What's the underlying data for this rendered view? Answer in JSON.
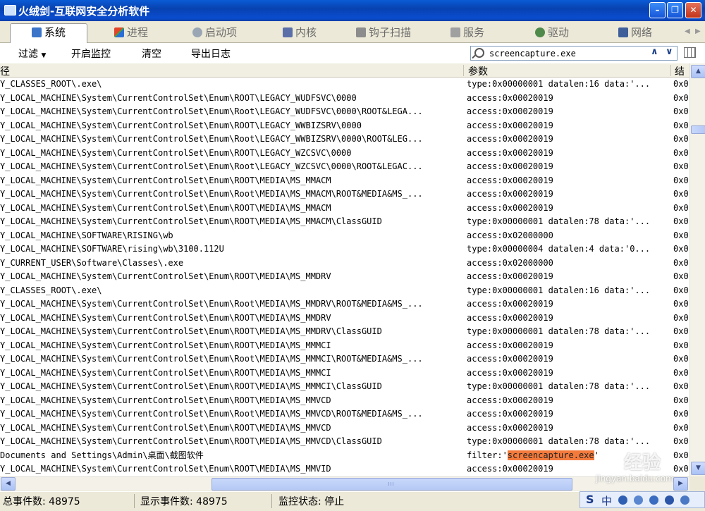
{
  "window": {
    "title": "火绒剑-互联网安全分析软件",
    "minimize": "–",
    "maximize": "❐",
    "close": "✕"
  },
  "tabs": [
    {
      "label": "系统",
      "icon": "monitor-icon",
      "active": true
    },
    {
      "label": "进程",
      "icon": "windows-flag-icon",
      "active": false
    },
    {
      "label": "启动项",
      "icon": "gear-icon",
      "active": false
    },
    {
      "label": "内核",
      "icon": "kernel-icon",
      "active": false
    },
    {
      "label": "钩子扫描",
      "icon": "hook-icon",
      "active": false
    },
    {
      "label": "服务",
      "icon": "service-icon",
      "active": false
    },
    {
      "label": "驱动",
      "icon": "driver-icon",
      "active": false
    },
    {
      "label": "网络",
      "icon": "network-icon",
      "active": false
    }
  ],
  "toolbar": {
    "filter": "过滤",
    "start_monitor": "开启监控",
    "clear": "清空",
    "export_log": "导出日志"
  },
  "search": {
    "value": "screencapture.exe",
    "up": "∧",
    "down": "∨"
  },
  "columns": {
    "path": "径",
    "params": "参数",
    "result": "结"
  },
  "rows": [
    {
      "path": "Y_CLASSES_ROOT\\.exe\\",
      "params": "type:0x00000001 datalen:16 data:'...",
      "result": "0x0"
    },
    {
      "path": "Y_LOCAL_MACHINE\\System\\CurrentControlSet\\Enum\\ROOT\\LEGACY_WUDFSVC\\0000",
      "params": "access:0x00020019",
      "result": "0x0"
    },
    {
      "path": "Y_LOCAL_MACHINE\\System\\CurrentControlSet\\Enum\\Root\\LEGACY_WUDFSVC\\0000\\ROOT&LEGA...",
      "params": "access:0x00020019",
      "result": "0x0"
    },
    {
      "path": "Y_LOCAL_MACHINE\\System\\CurrentControlSet\\Enum\\ROOT\\LEGACY_WWBIZSRV\\0000",
      "params": "access:0x00020019",
      "result": "0x0"
    },
    {
      "path": "Y_LOCAL_MACHINE\\System\\CurrentControlSet\\Enum\\Root\\LEGACY_WWBIZSRV\\0000\\ROOT&LEG...",
      "params": "access:0x00020019",
      "result": "0x0"
    },
    {
      "path": "Y_LOCAL_MACHINE\\System\\CurrentControlSet\\Enum\\ROOT\\LEGACY_WZCSVC\\0000",
      "params": "access:0x00020019",
      "result": "0x0"
    },
    {
      "path": "Y_LOCAL_MACHINE\\System\\CurrentControlSet\\Enum\\Root\\LEGACY_WZCSVC\\0000\\ROOT&LEGAC...",
      "params": "access:0x00020019",
      "result": "0x0"
    },
    {
      "path": "Y_LOCAL_MACHINE\\System\\CurrentControlSet\\Enum\\ROOT\\MEDIA\\MS_MMACM",
      "params": "access:0x00020019",
      "result": "0x0"
    },
    {
      "path": "Y_LOCAL_MACHINE\\System\\CurrentControlSet\\Enum\\Root\\MEDIA\\MS_MMACM\\ROOT&MEDIA&MS_...",
      "params": "access:0x00020019",
      "result": "0x0"
    },
    {
      "path": "Y_LOCAL_MACHINE\\System\\CurrentControlSet\\Enum\\ROOT\\MEDIA\\MS_MMACM",
      "params": "access:0x00020019",
      "result": "0x0"
    },
    {
      "path": "Y_LOCAL_MACHINE\\System\\CurrentControlSet\\Enum\\ROOT\\MEDIA\\MS_MMACM\\ClassGUID",
      "params": "type:0x00000001 datalen:78 data:'...",
      "result": "0x0"
    },
    {
      "path": "Y_LOCAL_MACHINE\\SOFTWARE\\RISING\\wb",
      "params": "access:0x02000000",
      "result": "0x0"
    },
    {
      "path": "Y_LOCAL_MACHINE\\SOFTWARE\\rising\\wb\\3100.112U",
      "params": "type:0x00000004 datalen:4 data:'0...",
      "result": "0x0"
    },
    {
      "path": "Y_CURRENT_USER\\Software\\Classes\\.exe",
      "params": "access:0x02000000",
      "result": "0x0"
    },
    {
      "path": "Y_LOCAL_MACHINE\\System\\CurrentControlSet\\Enum\\ROOT\\MEDIA\\MS_MMDRV",
      "params": "access:0x00020019",
      "result": "0x0"
    },
    {
      "path": "Y_CLASSES_ROOT\\.exe\\",
      "params": "type:0x00000001 datalen:16 data:'...",
      "result": "0x0"
    },
    {
      "path": "Y_LOCAL_MACHINE\\System\\CurrentControlSet\\Enum\\Root\\MEDIA\\MS_MMDRV\\ROOT&MEDIA&MS_...",
      "params": "access:0x00020019",
      "result": "0x0"
    },
    {
      "path": "Y_LOCAL_MACHINE\\System\\CurrentControlSet\\Enum\\ROOT\\MEDIA\\MS_MMDRV",
      "params": "access:0x00020019",
      "result": "0x0"
    },
    {
      "path": "Y_LOCAL_MACHINE\\System\\CurrentControlSet\\Enum\\ROOT\\MEDIA\\MS_MMDRV\\ClassGUID",
      "params": "type:0x00000001 datalen:78 data:'...",
      "result": "0x0"
    },
    {
      "path": "Y_LOCAL_MACHINE\\System\\CurrentControlSet\\Enum\\ROOT\\MEDIA\\MS_MMMCI",
      "params": "access:0x00020019",
      "result": "0x0"
    },
    {
      "path": "Y_LOCAL_MACHINE\\System\\CurrentControlSet\\Enum\\Root\\MEDIA\\MS_MMMCI\\ROOT&MEDIA&MS_...",
      "params": "access:0x00020019",
      "result": "0x0"
    },
    {
      "path": "Y_LOCAL_MACHINE\\System\\CurrentControlSet\\Enum\\ROOT\\MEDIA\\MS_MMMCI",
      "params": "access:0x00020019",
      "result": "0x0"
    },
    {
      "path": "Y_LOCAL_MACHINE\\System\\CurrentControlSet\\Enum\\ROOT\\MEDIA\\MS_MMMCI\\ClassGUID",
      "params": "type:0x00000001 datalen:78 data:'...",
      "result": "0x0"
    },
    {
      "path": "Y_LOCAL_MACHINE\\System\\CurrentControlSet\\Enum\\ROOT\\MEDIA\\MS_MMVCD",
      "params": "access:0x00020019",
      "result": "0x0"
    },
    {
      "path": "Y_LOCAL_MACHINE\\System\\CurrentControlSet\\Enum\\Root\\MEDIA\\MS_MMVCD\\ROOT&MEDIA&MS_...",
      "params": "access:0x00020019",
      "result": "0x0"
    },
    {
      "path": "Y_LOCAL_MACHINE\\System\\CurrentControlSet\\Enum\\ROOT\\MEDIA\\MS_MMVCD",
      "params": "access:0x00020019",
      "result": "0x0"
    },
    {
      "path": "Y_LOCAL_MACHINE\\System\\CurrentControlSet\\Enum\\ROOT\\MEDIA\\MS_MMVCD\\ClassGUID",
      "params": "type:0x00000001 datalen:78 data:'...",
      "result": "0x0"
    },
    {
      "path": "Documents and Settings\\Admin\\桌面\\截图软件",
      "params_prefix": "filter:'",
      "params_highlight": "screencapture.exe",
      "params_suffix": "'",
      "result": "0x0"
    },
    {
      "path": "Y_LOCAL_MACHINE\\System\\CurrentControlSet\\Enum\\ROOT\\MEDIA\\MS_MMVID",
      "params": "access:0x00020019",
      "result": "0x0"
    }
  ],
  "status": {
    "total_events": "总事件数: 48975",
    "shown_events": "显示事件数: 48975",
    "monitor_state": "监控状态: 停止"
  },
  "ime": {
    "logo": "S",
    "mode": "中"
  },
  "watermark": {
    "brand": "经验",
    "url": "jingyan.baidu.com"
  },
  "colors": {
    "titlebar": "#0a4ccf",
    "highlight": "#f47a3c"
  }
}
